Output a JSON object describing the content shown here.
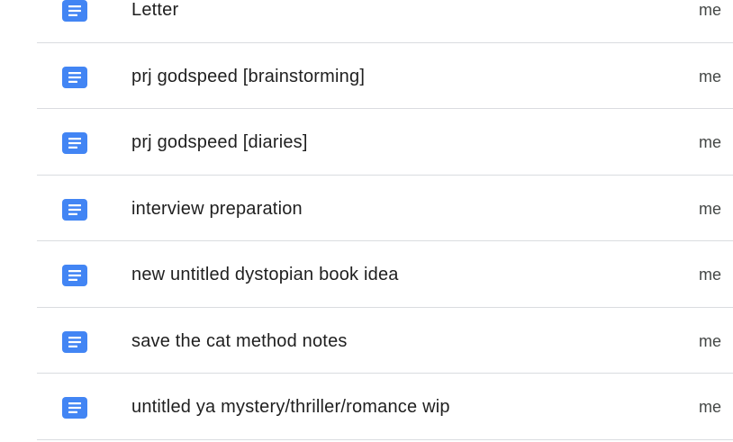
{
  "colors": {
    "doc_icon": "#4285f4",
    "divider": "#dadce0",
    "text_primary": "#1f1f1f",
    "text_secondary": "#444746"
  },
  "files": [
    {
      "name": "Letter",
      "owner": "me",
      "icon": "google-docs-icon"
    },
    {
      "name": "prj godspeed [brainstorming]",
      "owner": "me",
      "icon": "google-docs-icon"
    },
    {
      "name": "prj godspeed [diaries]",
      "owner": "me",
      "icon": "google-docs-icon"
    },
    {
      "name": "interview preparation",
      "owner": "me",
      "icon": "google-docs-icon"
    },
    {
      "name": "new untitled dystopian book idea",
      "owner": "me",
      "icon": "google-docs-icon"
    },
    {
      "name": "save the cat method notes",
      "owner": "me",
      "icon": "google-docs-icon"
    },
    {
      "name": "untitled ya mystery/thriller/romance wip",
      "owner": "me",
      "icon": "google-docs-icon"
    }
  ]
}
